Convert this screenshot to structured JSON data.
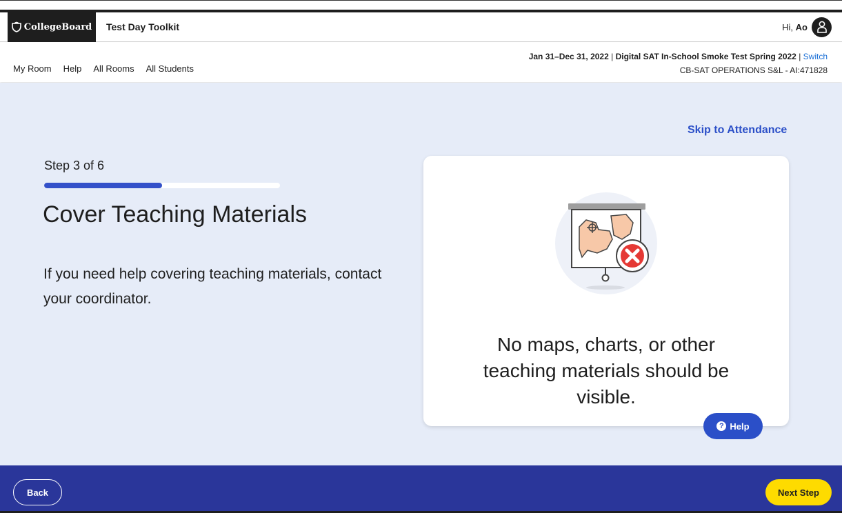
{
  "header": {
    "logo_text": "CollegeBoard",
    "app_title": "Test Day Toolkit",
    "greeting": "Hi,",
    "user_name": "Ao"
  },
  "subnav": {
    "links": [
      "My Room",
      "Help",
      "All Rooms",
      "All Students"
    ],
    "event_dates": "Jan 31–Dec 31, 2022",
    "event_name": "Digital SAT In-School Smoke Test Spring 2022",
    "switch_label": "Switch",
    "org": "CB-SAT OPERATIONS S&L - AI:471828"
  },
  "main": {
    "skip_link": "Skip to Attendance",
    "step_label": "Step 3 of 6",
    "progress_fraction": 0.5,
    "title": "Cover Teaching Materials",
    "description": "If you need help covering teaching materials, contact your coordinator.",
    "card_text": "No maps, charts, or other teaching materials should be visible.",
    "help_label": "Help"
  },
  "footer": {
    "back_label": "Back",
    "next_label": "Next Step"
  },
  "colors": {
    "brand_dark": "#1e1e1e",
    "accent_blue": "#2b4fc8",
    "footer_blue": "#2a369a",
    "page_bg": "#e6ecf8",
    "next_yellow": "#fedb00",
    "error_red": "#e53935"
  },
  "icons": [
    "acorn-logo-icon",
    "user-icon",
    "projector-map-icon",
    "error-x-icon",
    "question-circle-icon"
  ]
}
